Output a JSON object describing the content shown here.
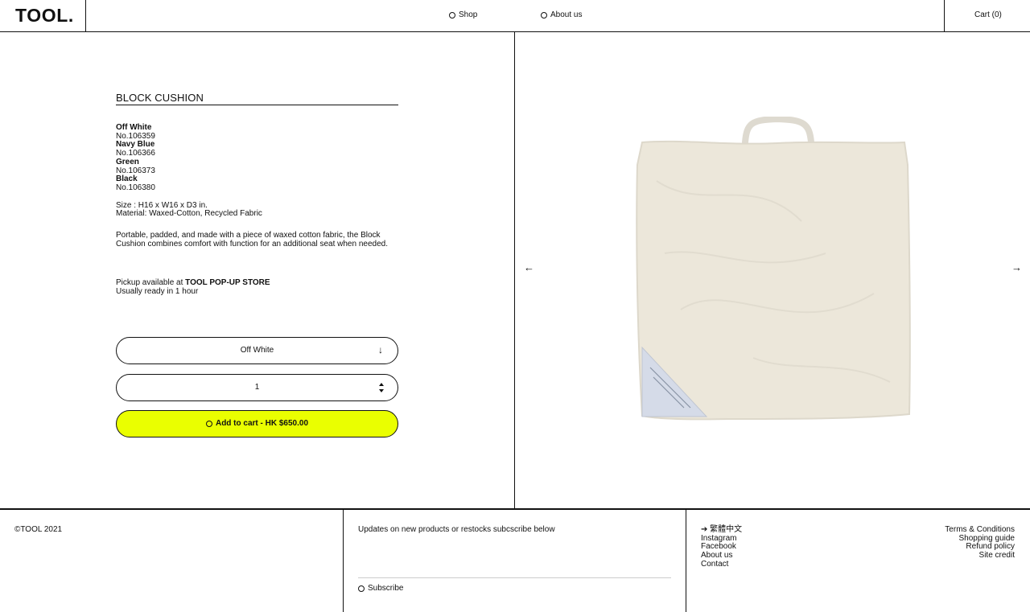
{
  "header": {
    "logo": "TOOL.",
    "nav": [
      {
        "label": "Shop"
      },
      {
        "label": "About us"
      }
    ],
    "cart": "Cart (0)"
  },
  "product": {
    "title": "BLOCK CUSHION",
    "variants": [
      {
        "name": "Off White",
        "number": "No.106359"
      },
      {
        "name": "Navy Blue",
        "number": "No.106366"
      },
      {
        "name": "Green",
        "number": "No.106373"
      },
      {
        "name": "Black",
        "number": "No.106380"
      }
    ],
    "size": "Size : H16 x W16 x D3 in.",
    "material": "Material: Waxed-Cotton, Recycled Fabric",
    "description": "Portable, padded, and made with a piece of waxed cotton fabric, the Block Cushion combines comfort with function for an additional seat when needed.",
    "pickup_prefix": "Pickup available at",
    "pickup_store": "TOOL POP-UP STORE",
    "pickup_time": "Usually ready in 1 hour",
    "selected_variant": "Off White",
    "quantity": "1",
    "add_to_cart": "Add to cart - HK $650.00",
    "accent_color": "#eaff00"
  },
  "gallery": {
    "prev": "←",
    "next": "→"
  },
  "footer": {
    "copyright": "©TOOL 2021",
    "newsletter": "Updates on new products or restocks subcscribe below",
    "subscribe": "Subscribe",
    "social": [
      "➔  繁體中文",
      "Instagram",
      "Facebook",
      "About us",
      "Contact"
    ],
    "legal": [
      "Terms & Conditions",
      "Shopping guide",
      "Refund policy",
      "Site credit"
    ]
  }
}
